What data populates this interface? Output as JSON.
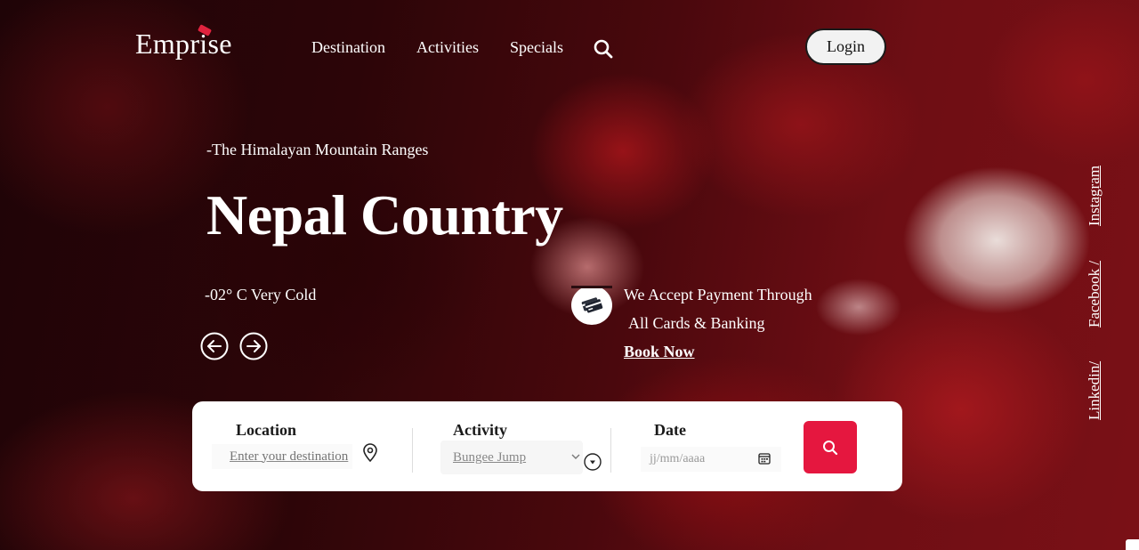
{
  "brand": {
    "name": "Emprise"
  },
  "nav": {
    "items": [
      "Destination",
      "Activities",
      "Specials"
    ],
    "login_label": "Login"
  },
  "hero": {
    "kicker": "-The Himalayan Mountain Ranges",
    "title": "Nepal Country",
    "weather": "-02° C Very Cold"
  },
  "payment": {
    "line1": "We Accept Payment Through",
    "line2": "All Cards & Banking",
    "cta": "Book Now"
  },
  "social": {
    "instagram": "Instagram",
    "facebook": "Facebook /",
    "linkedin": "Linkedin/"
  },
  "search": {
    "location_label": "Location",
    "location_placeholder": "Enter your destination",
    "activity_label": "Activity",
    "activity_value": "Bungee Jump",
    "date_label": "Date",
    "date_placeholder": "jj/mm/aaaa"
  },
  "colors": {
    "accent": "#e5173f",
    "panel": "#ffffff",
    "text": "#ffffff"
  },
  "icons": {
    "search": "search-icon",
    "prev": "arrow-left-circle-icon",
    "next": "arrow-right-circle-icon",
    "cards": "credit-cards-icon",
    "pin": "map-pin-icon",
    "calendar": "calendar-icon"
  }
}
